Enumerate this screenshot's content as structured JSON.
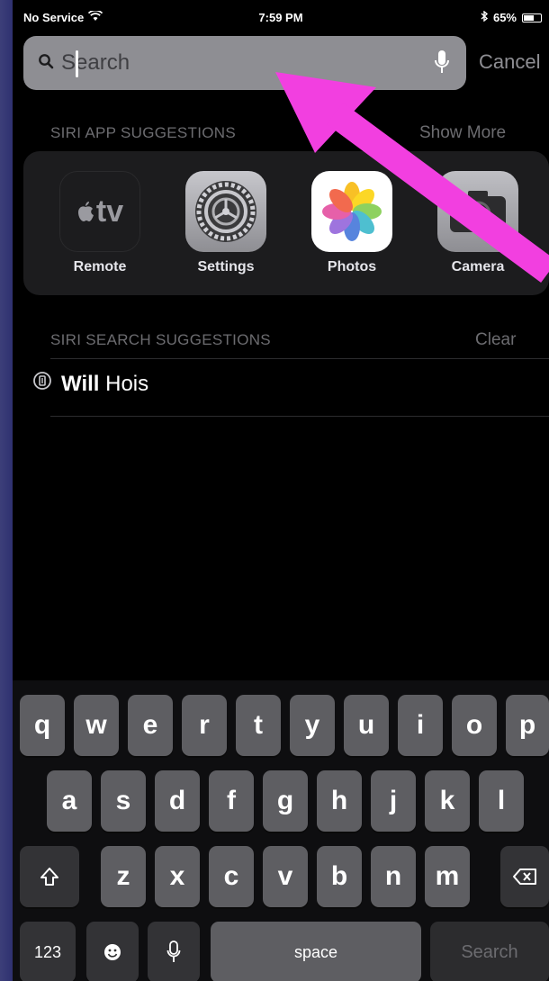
{
  "status_bar": {
    "carrier": "No Service",
    "time": "7:59 PM",
    "battery_percent": "65%",
    "battery_level": 0.65
  },
  "search": {
    "placeholder": "Search",
    "value": "",
    "cancel_label": "Cancel"
  },
  "siri_app_suggestions": {
    "header": "SIRI APP SUGGESTIONS",
    "action": "Show More",
    "apps": [
      {
        "label": "Remote",
        "icon": "apple-tv-remote-icon",
        "icon_text": "tv"
      },
      {
        "label": "Settings",
        "icon": "settings-gear-icon"
      },
      {
        "label": "Photos",
        "icon": "photos-flower-icon"
      },
      {
        "label": "Camera",
        "icon": "camera-icon"
      }
    ]
  },
  "siri_search_suggestions": {
    "header": "SIRI SEARCH SUGGESTIONS",
    "action": "Clear",
    "items": [
      {
        "bold": "Will",
        "rest": " Hois",
        "icon": "siri-suggestion-icon"
      }
    ]
  },
  "keyboard": {
    "row1": [
      "q",
      "w",
      "e",
      "r",
      "t",
      "y",
      "u",
      "i",
      "o",
      "p"
    ],
    "row2": [
      "a",
      "s",
      "d",
      "f",
      "g",
      "h",
      "j",
      "k",
      "l"
    ],
    "row3": [
      "z",
      "x",
      "c",
      "v",
      "b",
      "n",
      "m"
    ],
    "numbers_label": "123",
    "space_label": "space",
    "search_label": "Search"
  },
  "colors": {
    "annotation_arrow": "#f23fe0",
    "search_field": "#8e8e93",
    "panel": "#1c1c1e",
    "key": "#5e5e62"
  }
}
